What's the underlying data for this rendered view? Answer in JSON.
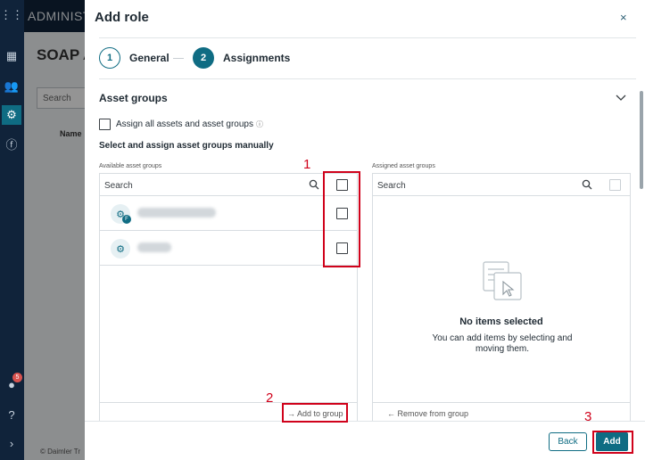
{
  "background": {
    "brand": "ADMINIST",
    "page_title": "SOAP A",
    "search_placeholder": "Search",
    "column_header": "Name",
    "footer_text": "© Daimler Tr",
    "notification_count": "5"
  },
  "dialog": {
    "title": "Add role",
    "close_glyph": "×",
    "steps": [
      {
        "number": "1",
        "label": "General"
      },
      {
        "number": "2",
        "label": "Assignments"
      }
    ],
    "section_title": "Asset groups",
    "assign_all_label": "Assign all assets and asset groups",
    "manual_title": "Select and assign asset groups manually",
    "available": {
      "label": "Available asset groups",
      "search_placeholder": "Search",
      "add_button": "Add to group"
    },
    "assigned": {
      "label": "Assigned asset groups",
      "search_placeholder": "Search",
      "empty_title": "No items selected",
      "empty_subtitle": "You can add items by selecting and moving them.",
      "remove_button": "Remove from group"
    },
    "back_button": "Back",
    "add_button": "Add"
  },
  "annotations": [
    "1",
    "2",
    "3"
  ],
  "colors": {
    "accent": "#0f6c83",
    "nav": "#10233a",
    "annotation": "#d0021b"
  }
}
